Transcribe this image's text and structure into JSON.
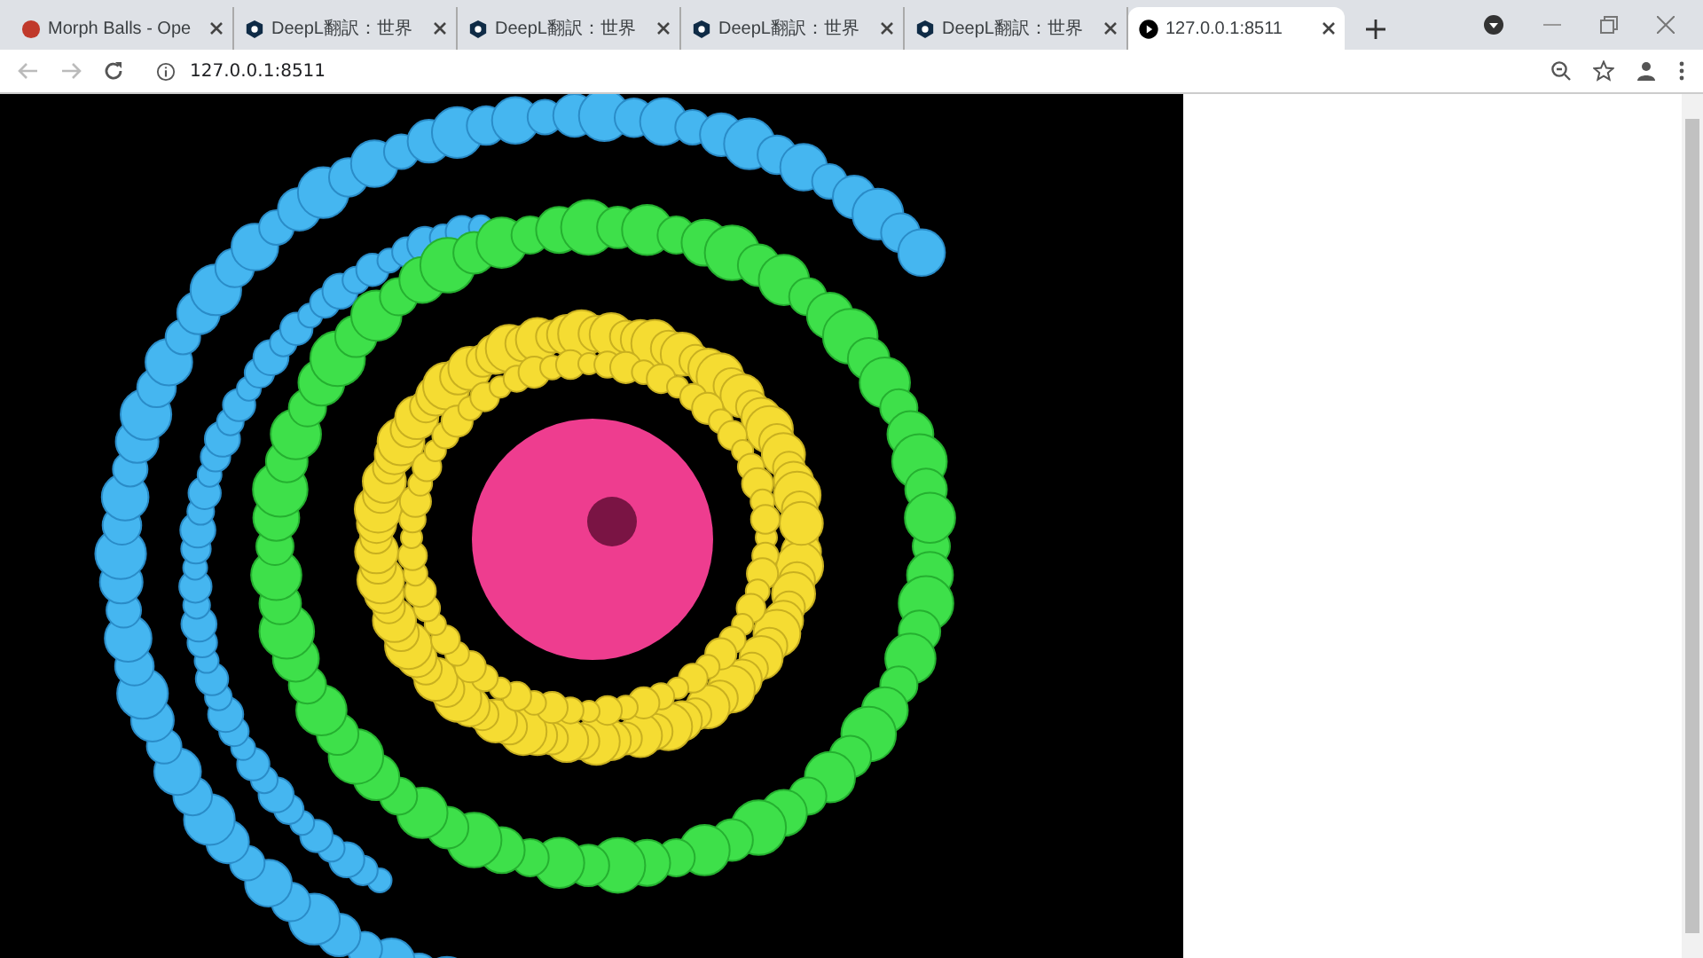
{
  "tabs": [
    {
      "title": "Morph Balls - Ope",
      "kind": "dot",
      "selected": false
    },
    {
      "title": "DeepL翻訳：世界",
      "kind": "deepl",
      "selected": false
    },
    {
      "title": "DeepL翻訳：世界",
      "kind": "deepl",
      "selected": false
    },
    {
      "title": "DeepL翻訳：世界",
      "kind": "deepl",
      "selected": false
    },
    {
      "title": "DeepL翻訳：世界",
      "kind": "deepl",
      "selected": false
    },
    {
      "title": "127.0.0.1:8511",
      "kind": "play",
      "selected": true
    }
  ],
  "address": "127.0.0.1:8511"
}
